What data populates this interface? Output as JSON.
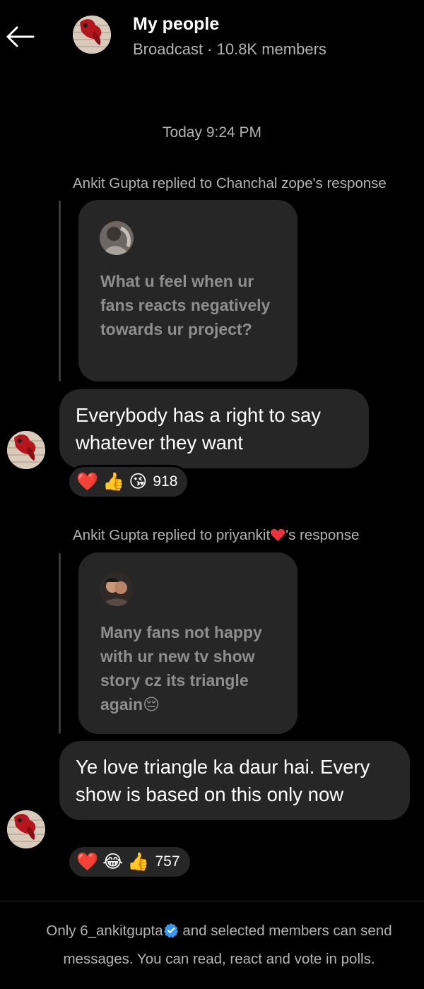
{
  "header": {
    "back_label": "←",
    "title": "My people",
    "subtitle": "Broadcast · 10.8K members"
  },
  "timestamp": "Today 9:24 PM",
  "messages": [
    {
      "reply_meta": "Ankit Gupta replied to Chanchal zope's response",
      "quote_text": "What u feel when ur fans reacts negatively towards ur project?",
      "text": "Everybody has a right to say whatever they want",
      "reactions": {
        "emojis": [
          "❤️",
          "👍",
          "😘"
        ],
        "count": "918"
      }
    },
    {
      "reply_meta_before": "Ankit Gupta replied to priyankit",
      "reply_meta_after": "'s response",
      "quote_text": "Many fans not happy with ur new tv show story cz its triangle again",
      "quote_emoji": "😔",
      "text": "Ye love triangle ka daur hai. Every show is based on this only now",
      "reactions": {
        "emojis": [
          "❤️",
          "😂",
          "👍"
        ],
        "count": "757"
      }
    }
  ],
  "footer": {
    "line1_before": "Only 6_ankitgupta",
    "line1_after": " and selected members can send",
    "line2": "messages. You can read, react and vote in polls."
  },
  "colors": {
    "background": "#000000",
    "bubble": "#262626",
    "muted_text": "#b3b3b3",
    "quote_text": "#8e8e8e",
    "heart": "#e8323c",
    "verified": "#3897f0"
  }
}
